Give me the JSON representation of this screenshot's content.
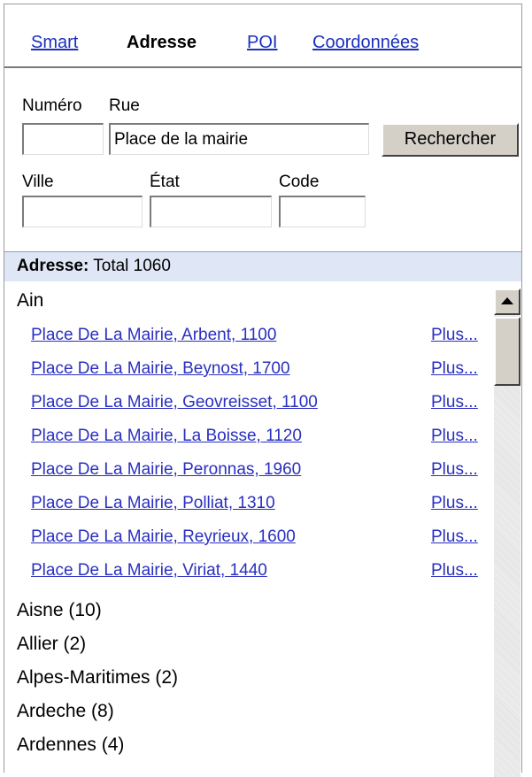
{
  "tabs": [
    {
      "label": "Smart",
      "active": false
    },
    {
      "label": "Adresse",
      "active": true
    },
    {
      "label": "POI",
      "active": false
    },
    {
      "label": "Coordonnées",
      "active": false
    }
  ],
  "form": {
    "numero_label": "Numéro",
    "rue_label": "Rue",
    "numero_value": "",
    "rue_value": "Place de la mairie",
    "search_button": "Rechercher",
    "ville_label": "Ville",
    "etat_label": "État",
    "code_label": "Code",
    "ville_value": "",
    "etat_value": "",
    "code_value": ""
  },
  "results": {
    "header_bold": "Adresse:",
    "header_total": "Total 1060",
    "group_ain": "Ain",
    "more_label": "Plus...",
    "items": [
      "Place De La Mairie, Arbent, 1100",
      "Place De La Mairie, Beynost, 1700",
      "Place De La Mairie, Geovreisset, 1100",
      "Place De La Mairie, La Boisse, 1120",
      "Place De La Mairie, Peronnas, 1960",
      "Place De La Mairie, Polliat, 1310",
      "Place De La Mairie, Reyrieux, 1600",
      "Place De La Mairie, Viriat, 1440"
    ],
    "groups": [
      "Aisne (10)",
      "Allier (2)",
      "Alpes-Maritimes (2)",
      "Ardeche (8)",
      "Ardennes (4)"
    ]
  },
  "colors": {
    "link": "#2a2fc0",
    "header_bg": "#dfe6f6"
  },
  "icons": {
    "scroll_up": "scroll-up-arrow-icon"
  }
}
